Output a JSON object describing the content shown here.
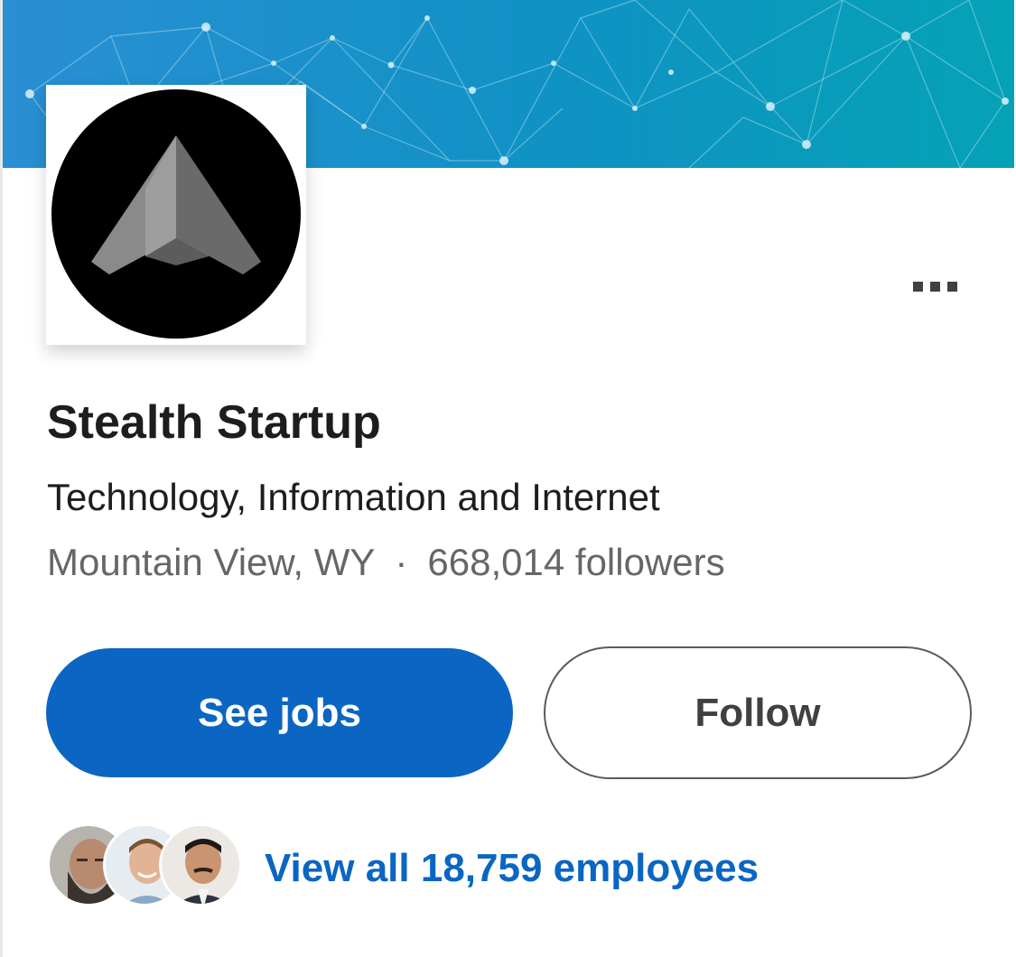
{
  "company": {
    "name": "Stealth Startup",
    "industry": "Technology, Information and Internet",
    "location": "Mountain View, WY",
    "separator": "·",
    "followers": "668,014 followers"
  },
  "actions": {
    "see_jobs_label": "See jobs",
    "follow_label": "Follow"
  },
  "employees": {
    "link_text": "View all 18,759 employees"
  },
  "icons": {
    "overflow": "more-horizontal-icon",
    "logo": "company-logo"
  },
  "colors": {
    "primary": "#0a66c2",
    "banner_start": "#1f8fd0",
    "banner_end": "#04a0b8",
    "text": "#1d1d1d",
    "muted": "#666666"
  }
}
